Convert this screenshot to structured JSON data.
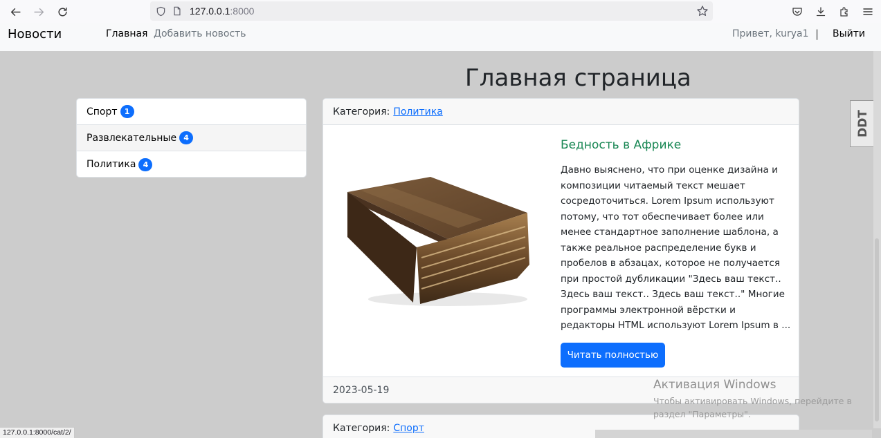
{
  "browser": {
    "url_host": "127.0.0.1",
    "url_port": ":8000"
  },
  "navbar": {
    "brand": "Новости",
    "links": [
      "Главная",
      "Добавить новость"
    ],
    "greeting": "Привет, kurya1",
    "separator": "|",
    "logout": "Выйти"
  },
  "page": {
    "title": "Главная страница"
  },
  "categories": [
    {
      "label": "Спорт",
      "count": "1"
    },
    {
      "label": "Развлекательные",
      "count": "4"
    },
    {
      "label": "Политика",
      "count": "4"
    }
  ],
  "news": [
    {
      "category_label": "Категория:",
      "category": "Политика",
      "title": "Бедность в Африке",
      "text": "Давно выяснено, что при оценке дизайна и композиции читаемый текст мешает сосредоточиться. Lorem Ipsum используют потому, что тот обеспечивает более или менее стандартное заполнение шаблона, а также реальное распределение букв и пробелов в абзацах, которое не получается при простой дубликации \"Здесь ваш текст.. Здесь ваш текст.. Здесь ваш текст..\" Многие программы электронной вёрстки и редакторы HTML используют Lorem Ipsum в ...",
      "button": "Читать полностью",
      "date": "2023-05-19"
    },
    {
      "category_label": "Категория:",
      "category": "Спорт"
    }
  ],
  "watermark": {
    "title": "Активация Windows",
    "text": "Чтобы активировать Windows, перейдите в раздел \"Параметры\"."
  },
  "extension_label": "DDT",
  "status_bar": "127.0.0.1:8000/cat/2/"
}
